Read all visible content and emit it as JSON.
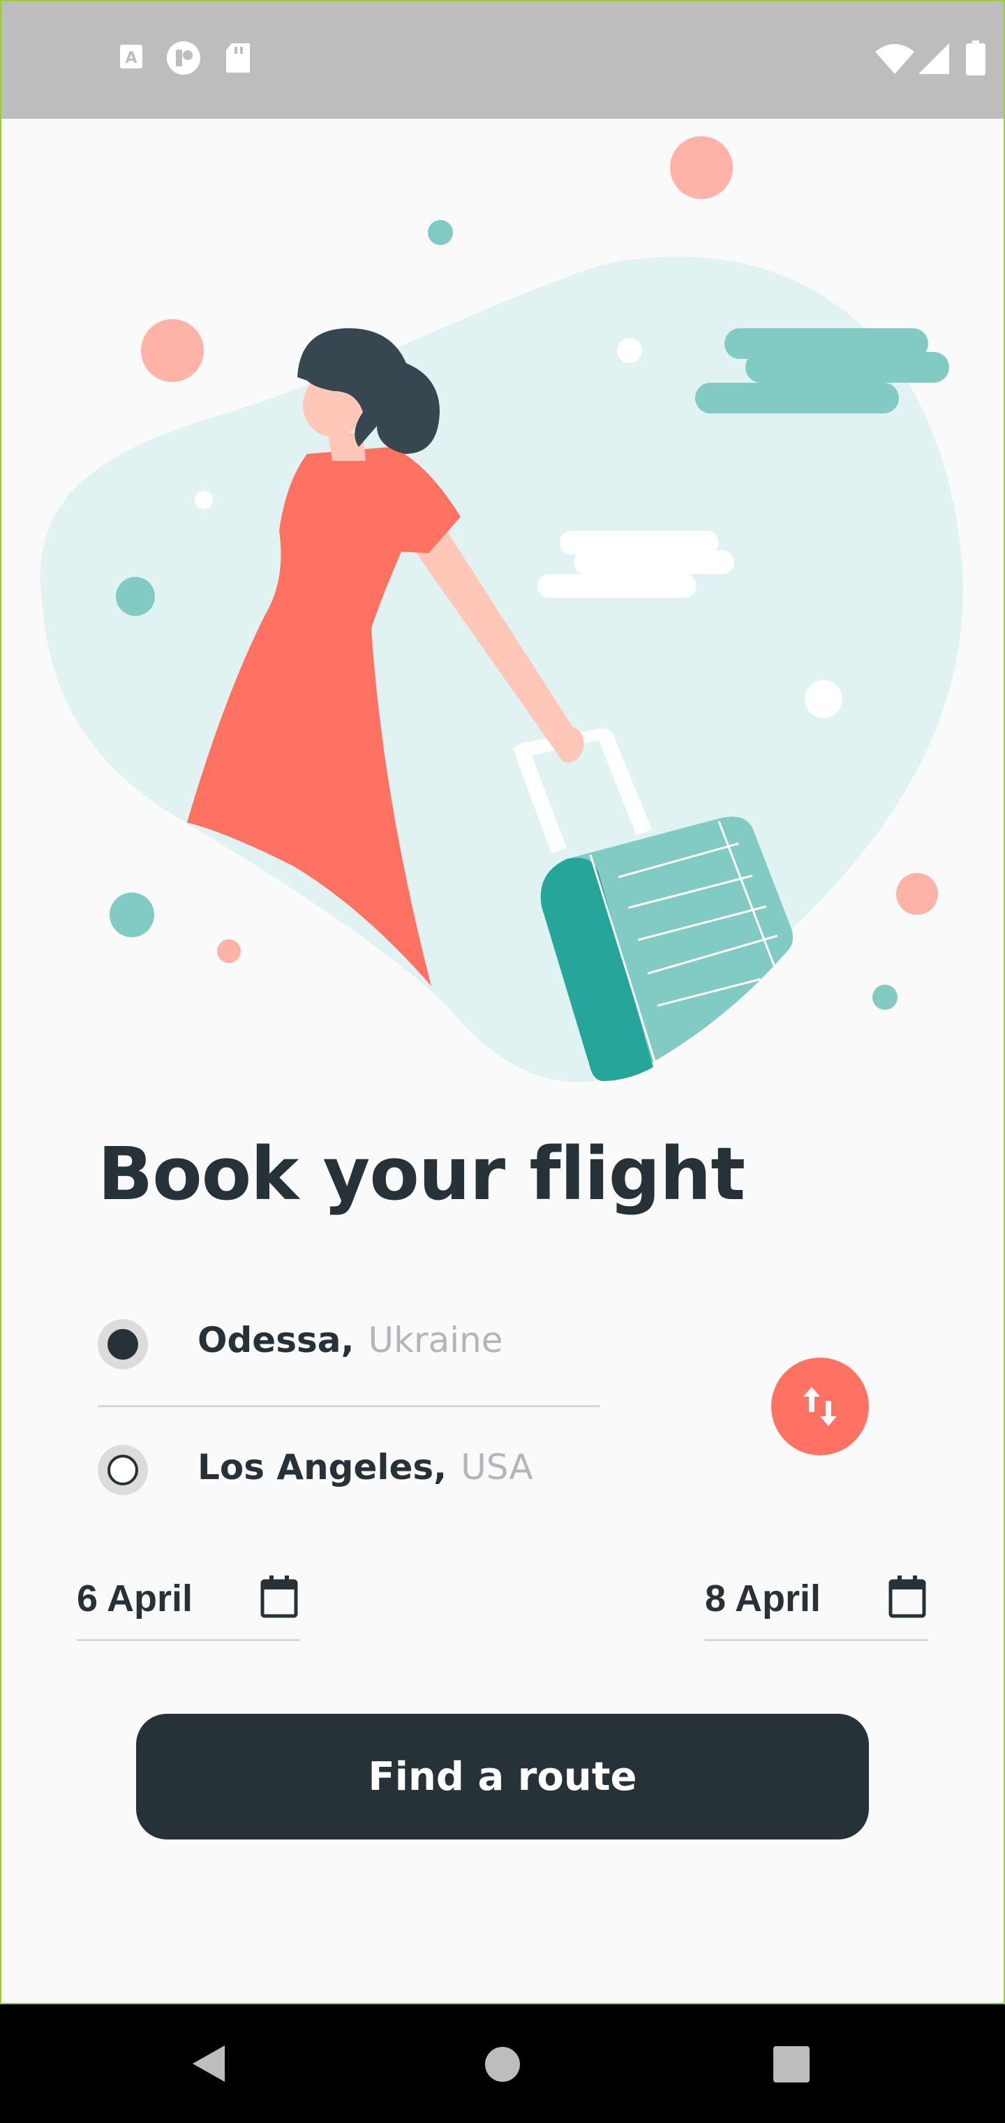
{
  "status_bar": {
    "left_icons": [
      "text-a-icon",
      "circle-notification-icon",
      "sd-card-icon"
    ],
    "right_icons": [
      "wifi-icon",
      "cellular-signal-icon",
      "battery-icon"
    ]
  },
  "illustration": {
    "description_icon": "traveler-with-suitcase-icon"
  },
  "title": "Book your flight",
  "route": {
    "from": {
      "city": "Odessa,",
      "country": "Ukraine",
      "selected": true
    },
    "to": {
      "city": "Los Angeles,",
      "country": "USA",
      "selected": false
    },
    "swap_icon": "swap-vertical-icon"
  },
  "dates": {
    "departure": "6 April",
    "return": "8 April"
  },
  "cta_label": "Find a route",
  "nav_bar": {
    "icons": [
      "back-icon",
      "home-icon",
      "recents-icon"
    ]
  },
  "colors": {
    "accent": "#ff7262",
    "dark": "#263238",
    "teal": "#82cbc4",
    "teal_dark": "#26a69a",
    "blob": "#e0f2f1",
    "pink": "#ffb3a7"
  }
}
